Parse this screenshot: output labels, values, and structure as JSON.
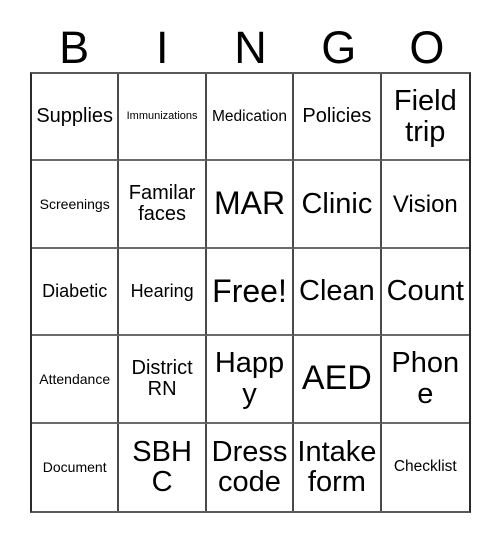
{
  "header": {
    "letters": [
      "B",
      "I",
      "N",
      "G",
      "O"
    ]
  },
  "grid": {
    "columns": 5,
    "rows": 5,
    "free_space_label": "Free!",
    "cells": [
      {
        "label": "Supplies",
        "size": "fs-l"
      },
      {
        "label": "Immunizations",
        "size": "fs-xxs"
      },
      {
        "label": "Medication",
        "size": "fs-s"
      },
      {
        "label": "Policies",
        "size": "fs-l"
      },
      {
        "label": "Field trip",
        "size": "fs-xxl"
      },
      {
        "label": "Screenings",
        "size": "fs-xs"
      },
      {
        "label": "Familar faces",
        "size": "fs-l"
      },
      {
        "label": "MAR",
        "size": "fs-3xl"
      },
      {
        "label": "Clinic",
        "size": "fs-xxl"
      },
      {
        "label": "Vision",
        "size": "fs-xl"
      },
      {
        "label": "Diabetic",
        "size": "fs-m"
      },
      {
        "label": "Hearing",
        "size": "fs-m"
      },
      {
        "label": "Free!",
        "size": "fs-3xl"
      },
      {
        "label": "Clean",
        "size": "fs-xxl"
      },
      {
        "label": "Count",
        "size": "fs-xxl"
      },
      {
        "label": "Attendance",
        "size": "fs-xs"
      },
      {
        "label": "District RN",
        "size": "fs-l"
      },
      {
        "label": "Happy",
        "size": "fs-xxl"
      },
      {
        "label": "AED",
        "size": "fs-4xl"
      },
      {
        "label": "Phone",
        "size": "fs-xxl"
      },
      {
        "label": "Document",
        "size": "fs-xs"
      },
      {
        "label": "SBHC",
        "size": "fs-xxl"
      },
      {
        "label": "Dress code",
        "size": "fs-xxl"
      },
      {
        "label": "Intake form",
        "size": "fs-xxl"
      },
      {
        "label": "Checklist",
        "size": "fs-s"
      }
    ]
  },
  "colors": {
    "background": "#ffffff",
    "text": "#000000",
    "grid_line": "#4a4a4a",
    "grid_border": "#2b2b2b"
  }
}
